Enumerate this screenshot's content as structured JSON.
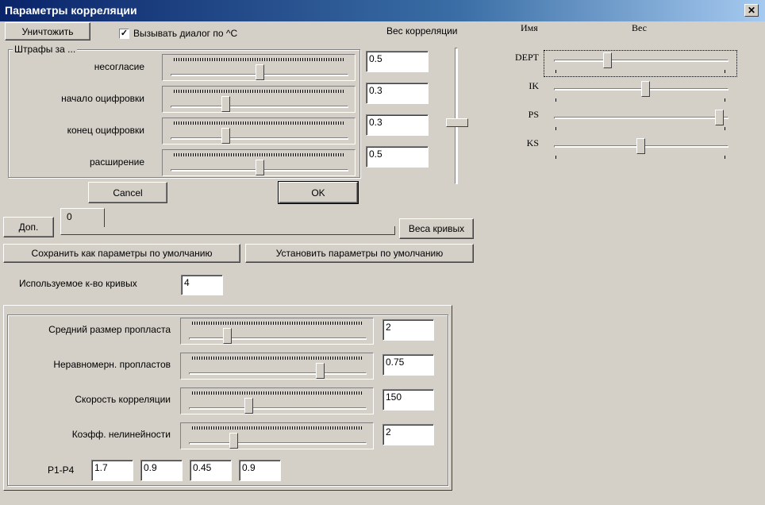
{
  "window": {
    "title": "Параметры корреляции",
    "close_glyph": "✕"
  },
  "top": {
    "destroy_label": "Уничтожить",
    "call_dialog_label": "Вызывать диалог по ^C",
    "call_dialog_checked": true,
    "corr_weight_label": "Вес корреляции",
    "corr_weight_value": 0.55
  },
  "penalties": {
    "caption": "Штрафы за ...",
    "rows": [
      {
        "label": "несогласие",
        "value": "0.5",
        "level": 0.5
      },
      {
        "label": "начало оцифровки",
        "value": "0.3",
        "level": 0.3
      },
      {
        "label": "конец оцифровки",
        "value": "0.3",
        "level": 0.3
      },
      {
        "label": "расширение",
        "value": "0.5",
        "level": 0.5
      }
    ]
  },
  "dialog_buttons": {
    "cancel_label": "Cancel",
    "ok_label": "OK"
  },
  "extra": {
    "dop_label": "Доп.",
    "tab_value": "0",
    "curve_weights_label": "Веса кривых",
    "save_defaults_label": "Сохранить как параметры по умолчанию",
    "set_defaults_label": "Установить параметры по умолчанию"
  },
  "curves_count": {
    "label": "Используемое к-во кривых",
    "value": "4"
  },
  "params": {
    "rows": [
      {
        "label": "Средний размер пропласта",
        "value": "2",
        "level": 0.2
      },
      {
        "label": "Неравномерн. пропластов",
        "value": "0.75",
        "level": 0.75
      },
      {
        "label": "Скорость корреляции",
        "value": "150",
        "level": 0.33
      },
      {
        "label": "Коэфф. нелинейности",
        "value": "2",
        "level": 0.24
      }
    ],
    "p_label": "P1-P4",
    "p_values": [
      "1.7",
      "0.9",
      "0.45",
      "0.9"
    ]
  },
  "curves_panel": {
    "name_header": "Имя",
    "weight_header": "Вес",
    "curves": [
      {
        "name": "DEPT",
        "level": 0.3
      },
      {
        "name": "IK",
        "level": 0.53
      },
      {
        "name": "PS",
        "level": 0.98
      },
      {
        "name": "KS",
        "level": 0.5
      }
    ]
  }
}
